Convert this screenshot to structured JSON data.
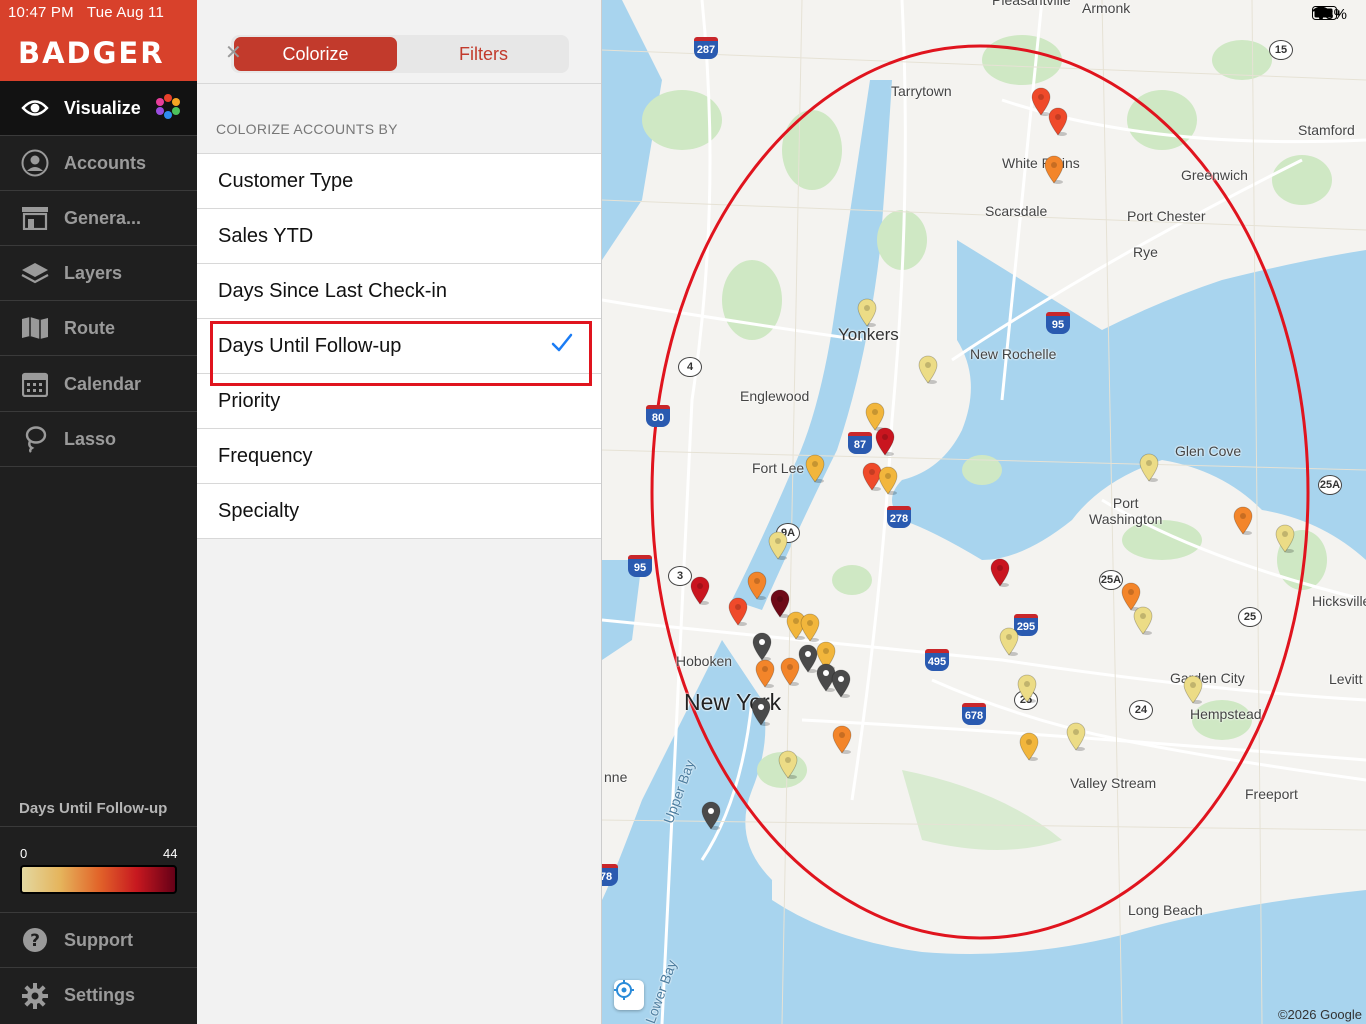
{
  "status_bar": {
    "time": "10:47 PM",
    "date": "Tue Aug 11",
    "battery": "78%"
  },
  "brand": "BADGER",
  "nav": [
    {
      "label": "Visualize",
      "icon": "eye-icon",
      "active": true
    },
    {
      "label": "Accounts",
      "icon": "person-icon",
      "active": false
    },
    {
      "label": "Genera...",
      "icon": "store-icon",
      "active": false
    },
    {
      "label": "Layers",
      "icon": "layers-icon",
      "active": false
    },
    {
      "label": "Route",
      "icon": "map-icon",
      "active": false
    },
    {
      "label": "Calendar",
      "icon": "calendar-icon",
      "active": false
    },
    {
      "label": "Lasso",
      "icon": "lasso-icon",
      "active": false
    }
  ],
  "legend": {
    "title": "Days Until Follow-up",
    "min": "0",
    "max": "44"
  },
  "footer_nav": [
    {
      "label": "Support",
      "icon": "help-icon"
    },
    {
      "label": "Settings",
      "icon": "gear-icon"
    }
  ],
  "panel": {
    "tabs": {
      "active": "Colorize",
      "inactive": "Filters"
    },
    "section_header": "COLORIZE ACCOUNTS BY",
    "options": [
      "Customer Type",
      "Sales YTD",
      "Days Since Last Check-in",
      "Days Until Follow-up",
      "Priority",
      "Frequency",
      "Specialty"
    ],
    "selected_option": "Days Until Follow-up"
  },
  "map": {
    "places": {
      "pleasantville": "Pleasantville",
      "armonk": "Armonk",
      "tarrytown": "Tarrytown",
      "white_plains": "White Plains",
      "stamford": "Stamford",
      "greenwich": "Greenwich",
      "scarsdale": "Scarsdale",
      "port_chester": "Port Chester",
      "rye": "Rye",
      "yonkers": "Yonkers",
      "new_rochelle": "New Rochelle",
      "englewood": "Englewood",
      "glen_cove": "Glen Cove",
      "fort_lee": "Fort Lee",
      "port_washington": "Port\nWashington",
      "hicksville": "Hicksville",
      "hoboken": "Hoboken",
      "new_york": "New York",
      "garden_city": "Garden City",
      "levittown": "Levitt",
      "hempstead": "Hempstead",
      "valley_stream": "Valley Stream",
      "freeport": "Freeport",
      "upper_bay": "Upper Bay",
      "long_beach": "Long Beach",
      "lower_bay": "Lower Bay",
      "bayonne": "nne"
    },
    "shields": [
      "287",
      "15",
      "95",
      "4",
      "87",
      "278",
      "9A",
      "95",
      "3",
      "25A",
      "25A",
      "295",
      "495",
      "25",
      "678",
      "25",
      "24",
      "78",
      "80"
    ],
    "copyright": "©2026 Google"
  }
}
